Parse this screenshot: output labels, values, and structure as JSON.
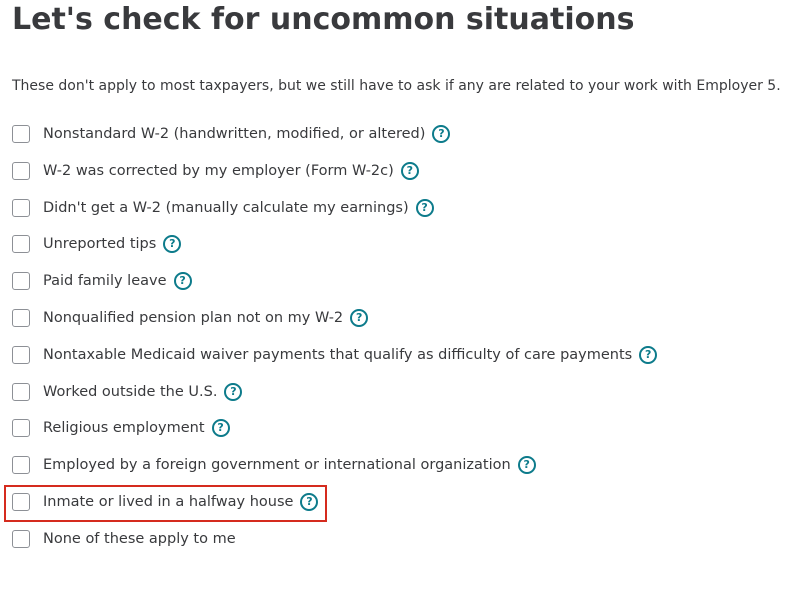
{
  "header": {
    "title": "Let's check for uncommon situations",
    "subtitle": "These don't apply to most taxpayers, but we still have to ask if any are related to your work with Employer 5."
  },
  "help_icon_glyph": "?",
  "colors": {
    "accent": "#0d7b8b",
    "highlight": "#d52b1e",
    "text": "#393a3d",
    "checkbox_border": "#8d9096"
  },
  "options": [
    {
      "label": "Nonstandard W-2 (handwritten, modified, or altered)",
      "checked": false,
      "has_help": true
    },
    {
      "label": "W-2 was corrected by my employer (Form W-2c)",
      "checked": false,
      "has_help": true
    },
    {
      "label": "Didn't get a W-2 (manually calculate my earnings)",
      "checked": false,
      "has_help": true
    },
    {
      "label": "Unreported tips",
      "checked": false,
      "has_help": true
    },
    {
      "label": "Paid family leave",
      "checked": false,
      "has_help": true
    },
    {
      "label": "Nonqualified pension plan not on my W-2",
      "checked": false,
      "has_help": true
    },
    {
      "label": "Nontaxable Medicaid waiver payments that qualify as difficulty of care payments",
      "checked": false,
      "has_help": true
    },
    {
      "label": "Worked outside the U.S.",
      "checked": false,
      "has_help": true
    },
    {
      "label": "Religious employment",
      "checked": false,
      "has_help": true
    },
    {
      "label": "Employed by a foreign government or international organization",
      "checked": false,
      "has_help": true
    },
    {
      "label": "Inmate or lived in a halfway house",
      "checked": false,
      "has_help": true
    },
    {
      "label": "None of these apply to me",
      "checked": false,
      "has_help": false
    }
  ]
}
